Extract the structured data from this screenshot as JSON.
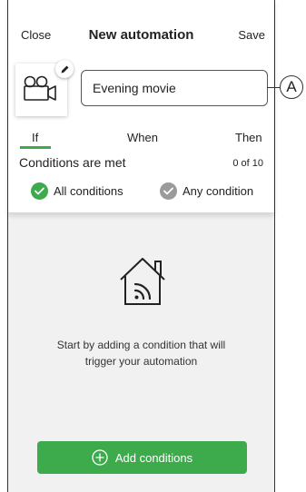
{
  "header": {
    "close_label": "Close",
    "title": "New automation",
    "save_label": "Save"
  },
  "automation": {
    "icon": "movie-camera-icon",
    "edit_icon": "pencil-icon",
    "name_value": "Evening movie"
  },
  "tabs": [
    {
      "label": "If",
      "active": true
    },
    {
      "label": "When",
      "active": false
    },
    {
      "label": "Then",
      "active": false
    }
  ],
  "conditions": {
    "label": "Conditions are met",
    "count": "0 of 10",
    "options": [
      {
        "label": "All conditions",
        "selected": true
      },
      {
        "label": "Any condition",
        "selected": false
      }
    ]
  },
  "empty_state": {
    "icon": "home-signal-icon",
    "text_line1": "Start by adding a condition that will",
    "text_line2": "trigger your automation"
  },
  "add_button": {
    "label": "Add conditions",
    "icon": "plus-circle-icon"
  },
  "callout": {
    "letter": "A"
  },
  "colors": {
    "accent": "#3dab4b",
    "inactive_check": "#9a9a9a",
    "panel_bg": "#f1f1f1"
  }
}
